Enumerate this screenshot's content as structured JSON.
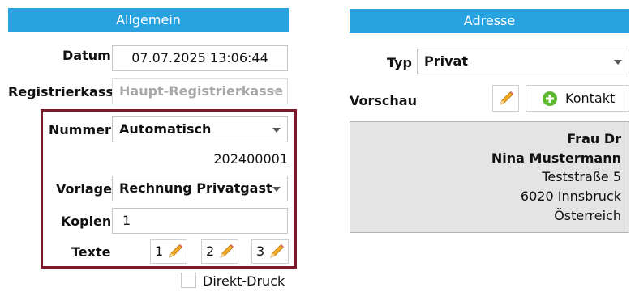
{
  "left_panel": {
    "header": "Allgemein",
    "datum_label": "Datum",
    "datum_value": "07.07.2025 13:06:44",
    "registrierkassa_label": "Registrierkassa",
    "registrierkassa_value": "Haupt-Registrierkasse",
    "nummer_label": "Nummer",
    "nummer_value": "Automatisch",
    "nummer_display": "202400001",
    "vorlage_label": "Vorlage",
    "vorlage_value": "Rechnung Privatgast",
    "kopien_label": "Kopien",
    "kopien_value": "1",
    "texte_label": "Texte",
    "texte_buttons": [
      "1",
      "2",
      "3"
    ],
    "direkt_druck_label": "Direkt-Druck",
    "direkt_druck_checked": false
  },
  "right_panel": {
    "header": "Adresse",
    "typ_label": "Typ",
    "typ_value": "Privat",
    "vorschau_label": "Vorschau",
    "kontakt_button": "Kontakt",
    "preview": {
      "line1": "Frau Dr",
      "line2": "Nina  Mustermann",
      "line3": "Teststraße 5",
      "line4": "6020  Innsbruck",
      "line5": "Österreich"
    }
  },
  "colors": {
    "header_bg": "#29a3e0",
    "group_border": "#7a1a2a",
    "preview_bg": "#e4e4e4",
    "kontakt_icon": "#5cb82e",
    "pencil": "#f2a922"
  },
  "icons": [
    "pencil-icon",
    "plus-circle-icon",
    "chevron-down-icon"
  ]
}
